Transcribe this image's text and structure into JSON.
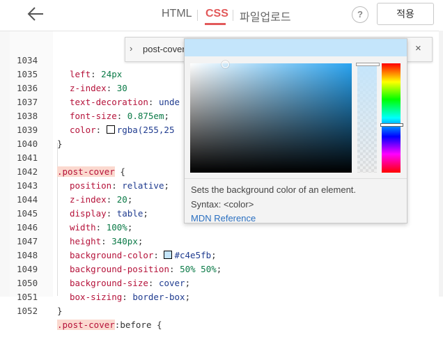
{
  "header": {
    "back_icon": "arrow-left-icon",
    "tabs": [
      "HTML",
      "CSS",
      "파일업로드"
    ],
    "active_tab": "CSS",
    "help_label": "?",
    "apply_label": "적용",
    "accent_color": "#e2595a"
  },
  "breadcrumb": {
    "text": "post-cover",
    "close_label": "×"
  },
  "color_picker": {
    "current_color": "#c4e5fb",
    "description": "Sets the background color of an element.",
    "syntax": "Syntax: <color>",
    "link": "MDN Reference"
  },
  "code": {
    "lines": [
      {
        "n": "1034",
        "prop": "left",
        "value": "24px"
      },
      {
        "n": "1035",
        "prop": "z-index",
        "value": "30"
      },
      {
        "n": "1036",
        "prop": "text-decoration",
        "value": "unde"
      },
      {
        "n": "1037",
        "prop": "font-size",
        "value": "0.875em"
      },
      {
        "n": "1038",
        "prop": "color",
        "value": "rgba(255,25"
      },
      {
        "n": "1039",
        "text": "}"
      },
      {
        "n": "1040",
        "text": ""
      },
      {
        "n": "1041",
        "selector": ".post-cover",
        "text": " {"
      },
      {
        "n": "1042",
        "prop": "position",
        "value": "relative"
      },
      {
        "n": "1043",
        "prop": "z-index",
        "value": "20"
      },
      {
        "n": "1044",
        "prop": "display",
        "value": "table"
      },
      {
        "n": "1045",
        "prop": "width",
        "value": "100%"
      },
      {
        "n": "1046",
        "prop": "height",
        "value": "340px"
      },
      {
        "n": "1047",
        "prop": "background-color",
        "value": "#c4e5fb"
      },
      {
        "n": "1048",
        "prop": "background-position",
        "value": "50% 50%"
      },
      {
        "n": "1049",
        "prop": "background-size",
        "value": "cover"
      },
      {
        "n": "1050",
        "prop": "box-sizing",
        "value": "border-box"
      },
      {
        "n": "1051",
        "text": "}"
      },
      {
        "n": "1052",
        "selector": ".post-cover",
        "text": ":before {"
      }
    ]
  }
}
